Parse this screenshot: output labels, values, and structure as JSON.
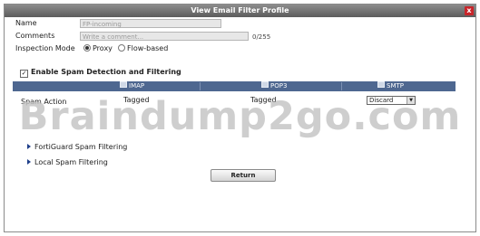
{
  "window": {
    "title": "View Email Filter Profile",
    "close_glyph": "x"
  },
  "form": {
    "name": {
      "label": "Name",
      "value": "FP-incoming"
    },
    "comments": {
      "label": "Comments",
      "placeholder": "Write a comment...",
      "counter": "0/255"
    },
    "inspection_mode": {
      "label": "Inspection Mode",
      "options": [
        "Proxy",
        "Flow-based"
      ],
      "selected": "Proxy"
    }
  },
  "spam": {
    "enable_label": "Enable Spam Detection and Filtering",
    "enabled": true,
    "columns": [
      "IMAP",
      "POP3",
      "SMTP"
    ],
    "rows": [
      {
        "label": "Spam Action",
        "imap": "Tagged",
        "pop3": "Tagged",
        "smtp": "Discard"
      }
    ]
  },
  "sections": [
    {
      "label": "FortiGuard Spam Filtering"
    },
    {
      "label": "Local Spam Filtering"
    }
  ],
  "buttons": {
    "return_label": "Return"
  },
  "colors": {
    "header_bg": "#4e6790",
    "titlebar_bg": "#6b6b6b",
    "close_bg": "#c8252a"
  },
  "watermark": "Braindump2go.com"
}
